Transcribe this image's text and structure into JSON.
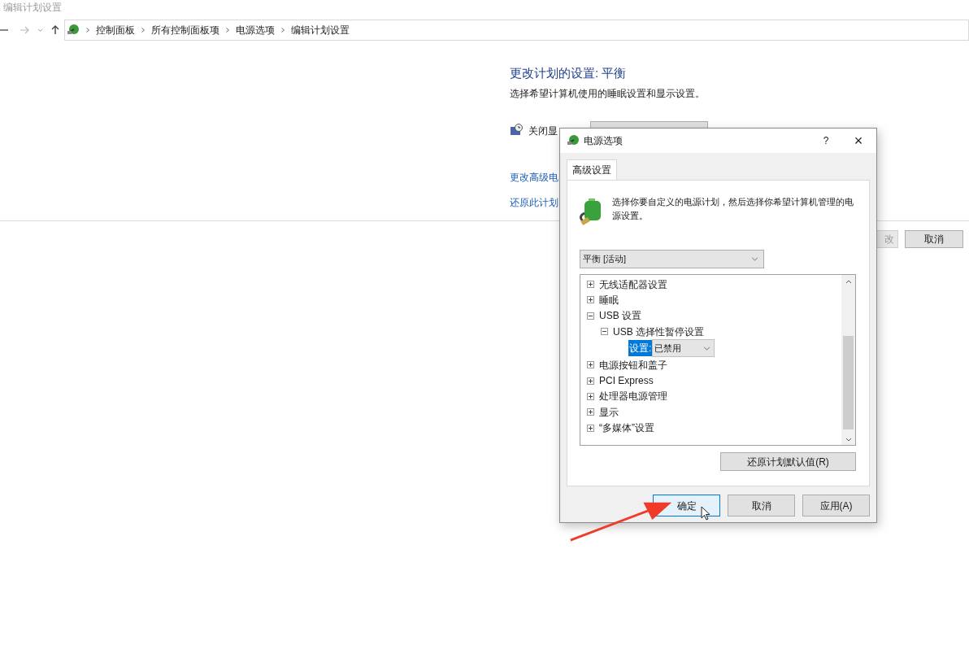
{
  "window": {
    "title": "编辑计划设置"
  },
  "breadcrumb": [
    "控制面板",
    "所有控制面板项",
    "电源选项",
    "编辑计划设置"
  ],
  "page": {
    "heading": "更改计划的设置: 平衡",
    "description": "选择希望计算机使用的睡眠设置和显示设置。",
    "display_label": "关闭显",
    "links": [
      "更改高级电",
      "还原此计划"
    ],
    "save_button": {
      "label": "改",
      "disabled": true
    },
    "cancel_button": "取消"
  },
  "dialog": {
    "title": "电源选项",
    "help": "?",
    "close": "×",
    "tabs": [
      {
        "label": "高级设置",
        "selected": true
      }
    ],
    "intro": "选择你要自定义的电源计划，然后选择你希望计算机管理的电源设置。",
    "plan": "平衡 [活动]",
    "tree": [
      {
        "label": "无线适配器设置",
        "expanded": false
      },
      {
        "label": "睡眠",
        "expanded": false
      },
      {
        "label": "USB 设置",
        "expanded": true,
        "children": [
          {
            "label": "USB 选择性暂停设置",
            "expanded": true,
            "setting": {
              "label": "设置:",
              "value": "已禁用"
            }
          }
        ]
      },
      {
        "label": "电源按钮和盖子",
        "expanded": false
      },
      {
        "label": "PCI Express",
        "expanded": false
      },
      {
        "label": "处理器电源管理",
        "expanded": false
      },
      {
        "label": "显示",
        "expanded": false
      },
      {
        "label": "“多媒体”设置",
        "expanded": false
      }
    ],
    "restore_button": "还原计划默认值(R)",
    "buttons": [
      {
        "label": "确定",
        "focused": true
      },
      {
        "label": "取消",
        "focused": false
      },
      {
        "label": "应用(A)",
        "focused": false
      }
    ]
  }
}
